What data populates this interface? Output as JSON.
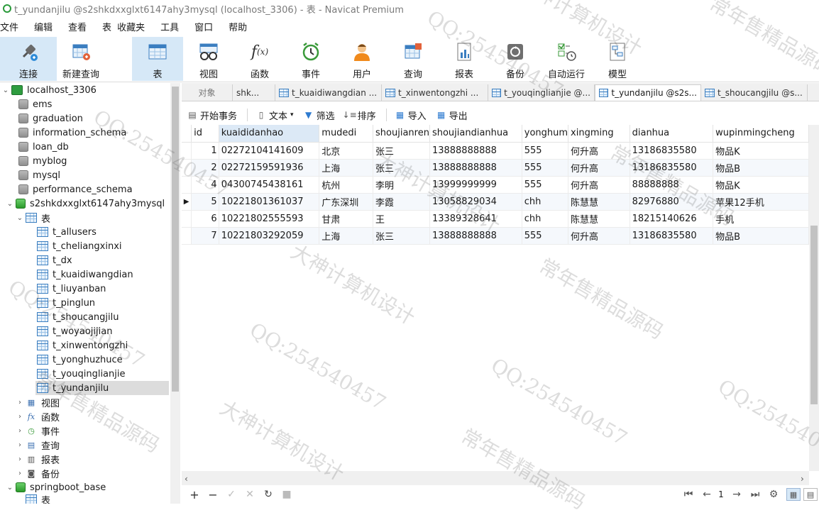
{
  "window": {
    "title": "t_yundanjilu @s2shkdxxglxt6147ahy3mysql (localhost_3306) - 表 - Navicat Premium"
  },
  "menu": [
    "文件",
    "编辑",
    "查看",
    "表",
    "收藏夹",
    "工具",
    "窗口",
    "帮助"
  ],
  "toolbar": {
    "connect": "连接",
    "new_query": "新建查询",
    "table": "表",
    "view": "视图",
    "function": "函数",
    "event": "事件",
    "user": "用户",
    "query": "查询",
    "report": "报表",
    "backup": "备份",
    "auto_run": "自动运行",
    "model": "模型"
  },
  "sidebar": {
    "connection": "localhost_3306",
    "databases": [
      "ems",
      "graduation",
      "information_schema",
      "loan_db",
      "myblog",
      "mysql",
      "performance_schema"
    ],
    "open_db": "s2shkdxxglxt6147ahy3mysql",
    "tables_label": "表",
    "tables": [
      "t_allusers",
      "t_cheliangxinxi",
      "t_dx",
      "t_kuaidiwangdian",
      "t_liuyanban",
      "t_pinglun",
      "t_shoucangjilu",
      "t_woyaojijian",
      "t_xinwentongzhi",
      "t_yonghuzhuce",
      "t_youqinglianjie",
      "t_yundanjilu"
    ],
    "selected_table": "t_yundanjilu",
    "groups": [
      "视图",
      "函数",
      "事件",
      "查询",
      "报表",
      "备份"
    ],
    "next_db": "springboot_base",
    "next_db_child": "表"
  },
  "tabs": [
    "对象",
    "shk...",
    "t_kuaidiwangdian ...",
    "t_xinwentongzhi ...",
    "t_youqinglianjie @...",
    "t_yundanjilu @s2s...",
    "t_shoucangjilu @s..."
  ],
  "grid_toolbar": {
    "begin_tx": "开始事务",
    "text": "文本",
    "filter": "筛选",
    "sort": "排序",
    "import": "导入",
    "export": "导出"
  },
  "grid": {
    "columns": [
      "id",
      "kuaididanhao",
      "mudedi",
      "shoujianren",
      "shoujiandianhua",
      "yonghum",
      "xingming",
      "dianhua",
      "wupinmingcheng"
    ],
    "rows": [
      [
        "1",
        "02272104141609",
        "北京",
        "张三",
        "13888888888",
        "555",
        "何升高",
        "13186835580",
        "物品K"
      ],
      [
        "2",
        "02272159591936",
        "上海",
        "张三",
        "13888888888",
        "555",
        "何升高",
        "13186835580",
        "物品B"
      ],
      [
        "4",
        "04300745438161",
        "杭州",
        "李明",
        "13999999999",
        "555",
        "何升高",
        "88888888",
        "物品K"
      ],
      [
        "5",
        "10221801361037",
        "广东深圳",
        "李霞",
        "13058829034",
        "chh",
        "陈慧慧",
        "82976880",
        "苹果12手机"
      ],
      [
        "6",
        "10221802555593",
        "甘肃",
        "王",
        "13389328641",
        "chh",
        "陈慧慧",
        "18215140626",
        "手机"
      ],
      [
        "7",
        "10221803292059",
        "上海",
        "张三",
        "13888888888",
        "555",
        "何升高",
        "13186835580",
        "物品B"
      ]
    ],
    "current_row": 3
  },
  "status": {
    "page": "1"
  },
  "watermarks": [
    "QQ:254540457",
    "大神计算机设计",
    "常年售精品源码"
  ]
}
